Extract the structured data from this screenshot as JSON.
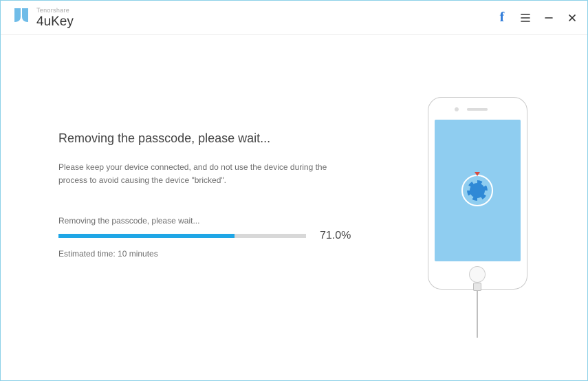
{
  "brand": {
    "company": "Tenorshare",
    "product": "4uKey"
  },
  "main": {
    "heading": "Removing the passcode, please wait...",
    "description": "Please keep your device connected, and do not use the device during the process to avoid causing the device \"bricked\".",
    "status": "Removing the passcode, please wait...",
    "percent_text": "71.0%",
    "progress_value": 71.0,
    "estimate": "Estimated time: 10 minutes"
  },
  "colors": {
    "accent": "#1fa6e6",
    "screen": "#8fcdf0"
  }
}
